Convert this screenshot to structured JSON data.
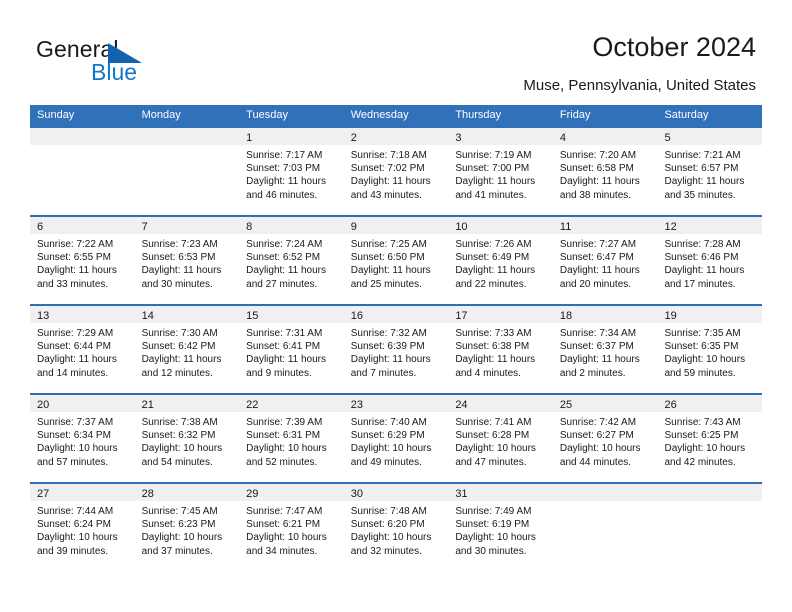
{
  "brand": {
    "name_top": "General",
    "name_bottom": "Blue",
    "accent_color": "#1675c8",
    "triangle_color": "#1263ad"
  },
  "header": {
    "title": "October 2024",
    "subtitle": "Muse, Pennsylvania, United States"
  },
  "calendar": {
    "header_bg": "#3071b9",
    "row_border_color": "#2f6fb5",
    "day_band_bg": "#f0f0f0",
    "weekdays": [
      "Sunday",
      "Monday",
      "Tuesday",
      "Wednesday",
      "Thursday",
      "Friday",
      "Saturday"
    ],
    "weeks": [
      [
        {
          "day": "",
          "sunrise": "",
          "sunset": "",
          "daylight": ""
        },
        {
          "day": "",
          "sunrise": "",
          "sunset": "",
          "daylight": ""
        },
        {
          "day": "1",
          "sunrise": "Sunrise: 7:17 AM",
          "sunset": "Sunset: 7:03 PM",
          "daylight": "Daylight: 11 hours and 46 minutes."
        },
        {
          "day": "2",
          "sunrise": "Sunrise: 7:18 AM",
          "sunset": "Sunset: 7:02 PM",
          "daylight": "Daylight: 11 hours and 43 minutes."
        },
        {
          "day": "3",
          "sunrise": "Sunrise: 7:19 AM",
          "sunset": "Sunset: 7:00 PM",
          "daylight": "Daylight: 11 hours and 41 minutes."
        },
        {
          "day": "4",
          "sunrise": "Sunrise: 7:20 AM",
          "sunset": "Sunset: 6:58 PM",
          "daylight": "Daylight: 11 hours and 38 minutes."
        },
        {
          "day": "5",
          "sunrise": "Sunrise: 7:21 AM",
          "sunset": "Sunset: 6:57 PM",
          "daylight": "Daylight: 11 hours and 35 minutes."
        }
      ],
      [
        {
          "day": "6",
          "sunrise": "Sunrise: 7:22 AM",
          "sunset": "Sunset: 6:55 PM",
          "daylight": "Daylight: 11 hours and 33 minutes."
        },
        {
          "day": "7",
          "sunrise": "Sunrise: 7:23 AM",
          "sunset": "Sunset: 6:53 PM",
          "daylight": "Daylight: 11 hours and 30 minutes."
        },
        {
          "day": "8",
          "sunrise": "Sunrise: 7:24 AM",
          "sunset": "Sunset: 6:52 PM",
          "daylight": "Daylight: 11 hours and 27 minutes."
        },
        {
          "day": "9",
          "sunrise": "Sunrise: 7:25 AM",
          "sunset": "Sunset: 6:50 PM",
          "daylight": "Daylight: 11 hours and 25 minutes."
        },
        {
          "day": "10",
          "sunrise": "Sunrise: 7:26 AM",
          "sunset": "Sunset: 6:49 PM",
          "daylight": "Daylight: 11 hours and 22 minutes."
        },
        {
          "day": "11",
          "sunrise": "Sunrise: 7:27 AM",
          "sunset": "Sunset: 6:47 PM",
          "daylight": "Daylight: 11 hours and 20 minutes."
        },
        {
          "day": "12",
          "sunrise": "Sunrise: 7:28 AM",
          "sunset": "Sunset: 6:46 PM",
          "daylight": "Daylight: 11 hours and 17 minutes."
        }
      ],
      [
        {
          "day": "13",
          "sunrise": "Sunrise: 7:29 AM",
          "sunset": "Sunset: 6:44 PM",
          "daylight": "Daylight: 11 hours and 14 minutes."
        },
        {
          "day": "14",
          "sunrise": "Sunrise: 7:30 AM",
          "sunset": "Sunset: 6:42 PM",
          "daylight": "Daylight: 11 hours and 12 minutes."
        },
        {
          "day": "15",
          "sunrise": "Sunrise: 7:31 AM",
          "sunset": "Sunset: 6:41 PM",
          "daylight": "Daylight: 11 hours and 9 minutes."
        },
        {
          "day": "16",
          "sunrise": "Sunrise: 7:32 AM",
          "sunset": "Sunset: 6:39 PM",
          "daylight": "Daylight: 11 hours and 7 minutes."
        },
        {
          "day": "17",
          "sunrise": "Sunrise: 7:33 AM",
          "sunset": "Sunset: 6:38 PM",
          "daylight": "Daylight: 11 hours and 4 minutes."
        },
        {
          "day": "18",
          "sunrise": "Sunrise: 7:34 AM",
          "sunset": "Sunset: 6:37 PM",
          "daylight": "Daylight: 11 hours and 2 minutes."
        },
        {
          "day": "19",
          "sunrise": "Sunrise: 7:35 AM",
          "sunset": "Sunset: 6:35 PM",
          "daylight": "Daylight: 10 hours and 59 minutes."
        }
      ],
      [
        {
          "day": "20",
          "sunrise": "Sunrise: 7:37 AM",
          "sunset": "Sunset: 6:34 PM",
          "daylight": "Daylight: 10 hours and 57 minutes."
        },
        {
          "day": "21",
          "sunrise": "Sunrise: 7:38 AM",
          "sunset": "Sunset: 6:32 PM",
          "daylight": "Daylight: 10 hours and 54 minutes."
        },
        {
          "day": "22",
          "sunrise": "Sunrise: 7:39 AM",
          "sunset": "Sunset: 6:31 PM",
          "daylight": "Daylight: 10 hours and 52 minutes."
        },
        {
          "day": "23",
          "sunrise": "Sunrise: 7:40 AM",
          "sunset": "Sunset: 6:29 PM",
          "daylight": "Daylight: 10 hours and 49 minutes."
        },
        {
          "day": "24",
          "sunrise": "Sunrise: 7:41 AM",
          "sunset": "Sunset: 6:28 PM",
          "daylight": "Daylight: 10 hours and 47 minutes."
        },
        {
          "day": "25",
          "sunrise": "Sunrise: 7:42 AM",
          "sunset": "Sunset: 6:27 PM",
          "daylight": "Daylight: 10 hours and 44 minutes."
        },
        {
          "day": "26",
          "sunrise": "Sunrise: 7:43 AM",
          "sunset": "Sunset: 6:25 PM",
          "daylight": "Daylight: 10 hours and 42 minutes."
        }
      ],
      [
        {
          "day": "27",
          "sunrise": "Sunrise: 7:44 AM",
          "sunset": "Sunset: 6:24 PM",
          "daylight": "Daylight: 10 hours and 39 minutes."
        },
        {
          "day": "28",
          "sunrise": "Sunrise: 7:45 AM",
          "sunset": "Sunset: 6:23 PM",
          "daylight": "Daylight: 10 hours and 37 minutes."
        },
        {
          "day": "29",
          "sunrise": "Sunrise: 7:47 AM",
          "sunset": "Sunset: 6:21 PM",
          "daylight": "Daylight: 10 hours and 34 minutes."
        },
        {
          "day": "30",
          "sunrise": "Sunrise: 7:48 AM",
          "sunset": "Sunset: 6:20 PM",
          "daylight": "Daylight: 10 hours and 32 minutes."
        },
        {
          "day": "31",
          "sunrise": "Sunrise: 7:49 AM",
          "sunset": "Sunset: 6:19 PM",
          "daylight": "Daylight: 10 hours and 30 minutes."
        },
        {
          "day": "",
          "sunrise": "",
          "sunset": "",
          "daylight": ""
        },
        {
          "day": "",
          "sunrise": "",
          "sunset": "",
          "daylight": ""
        }
      ]
    ]
  }
}
